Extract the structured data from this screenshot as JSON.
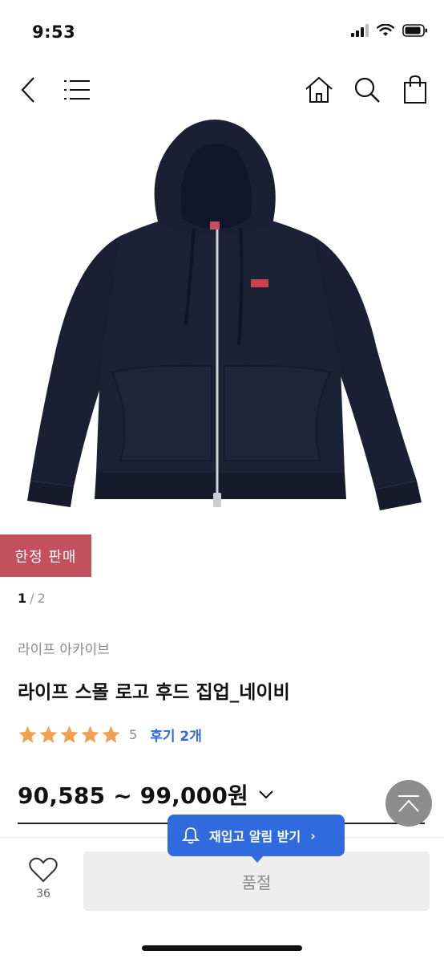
{
  "status": {
    "time": "9:53"
  },
  "nav": {
    "icons": [
      "back-icon",
      "menu-icon",
      "home-icon",
      "search-icon",
      "shopping-bag-icon"
    ]
  },
  "product": {
    "badge": "한정 판매",
    "image_alt": "navy zip-up hoodie",
    "image_logo_text": "LIFE",
    "pager": {
      "current": "1",
      "separator": "/",
      "total": "2"
    },
    "brand": "라이프 아카이브",
    "title": "라이프 스몰 로고 후드 집업_네이비",
    "rating": {
      "stars": 5,
      "score": "5",
      "review_label": "후기 2개"
    },
    "price": "90,585 ~ 99,000원"
  },
  "restock_tooltip": {
    "label": "재입고 알림 받기",
    "chevron": "›"
  },
  "bottom": {
    "like_count": "36",
    "soldout_label": "품절"
  },
  "colors": {
    "badge": "#c4505e",
    "accent_blue": "#2f6bde",
    "star": "#f0a050",
    "hoodie": "#1a1f33"
  }
}
